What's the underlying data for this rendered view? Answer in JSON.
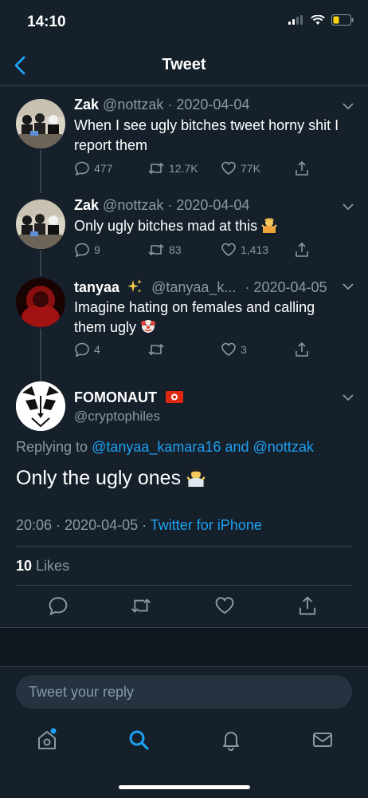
{
  "status_bar": {
    "time": "14:10"
  },
  "nav": {
    "title": "Tweet"
  },
  "thread": [
    {
      "name": "Zak",
      "handle": "@nottzak",
      "date": "· 2020-04-04",
      "text": "When I see ugly bitches tweet horny shit I report them",
      "replies": "477",
      "retweets": "12.7K",
      "likes": "77K"
    },
    {
      "name": "Zak",
      "handle": "@nottzak",
      "date": "· 2020-04-04",
      "text": "Only ugly bitches mad at this",
      "replies": "9",
      "retweets": "83",
      "likes": "1,413"
    },
    {
      "name": "tanyaa",
      "handle": "@tanyaa_k...",
      "date": "· 2020-04-05",
      "text": "Imagine hating on females and calling them ugly",
      "replies": "4",
      "retweets": "",
      "likes": "3"
    }
  ],
  "main_tweet": {
    "name": "FOMONAUT",
    "handle": "@cryptophiles",
    "replying_prefix": "Replying to",
    "replying_user1": "@tanyaa_kamara16",
    "replying_and": "and",
    "replying_user2": "@nottzak",
    "text": "Only the ugly ones",
    "time": "20:06 · 2020-04-05 ·",
    "source": "Twitter for iPhone",
    "likes_count": "10",
    "likes_label": "Likes"
  },
  "reply_box": {
    "placeholder": "Tweet your reply"
  },
  "colors": {
    "background": "#15202b",
    "accent": "#1da1f2",
    "muted": "#8899a6",
    "divider": "#38444d"
  }
}
